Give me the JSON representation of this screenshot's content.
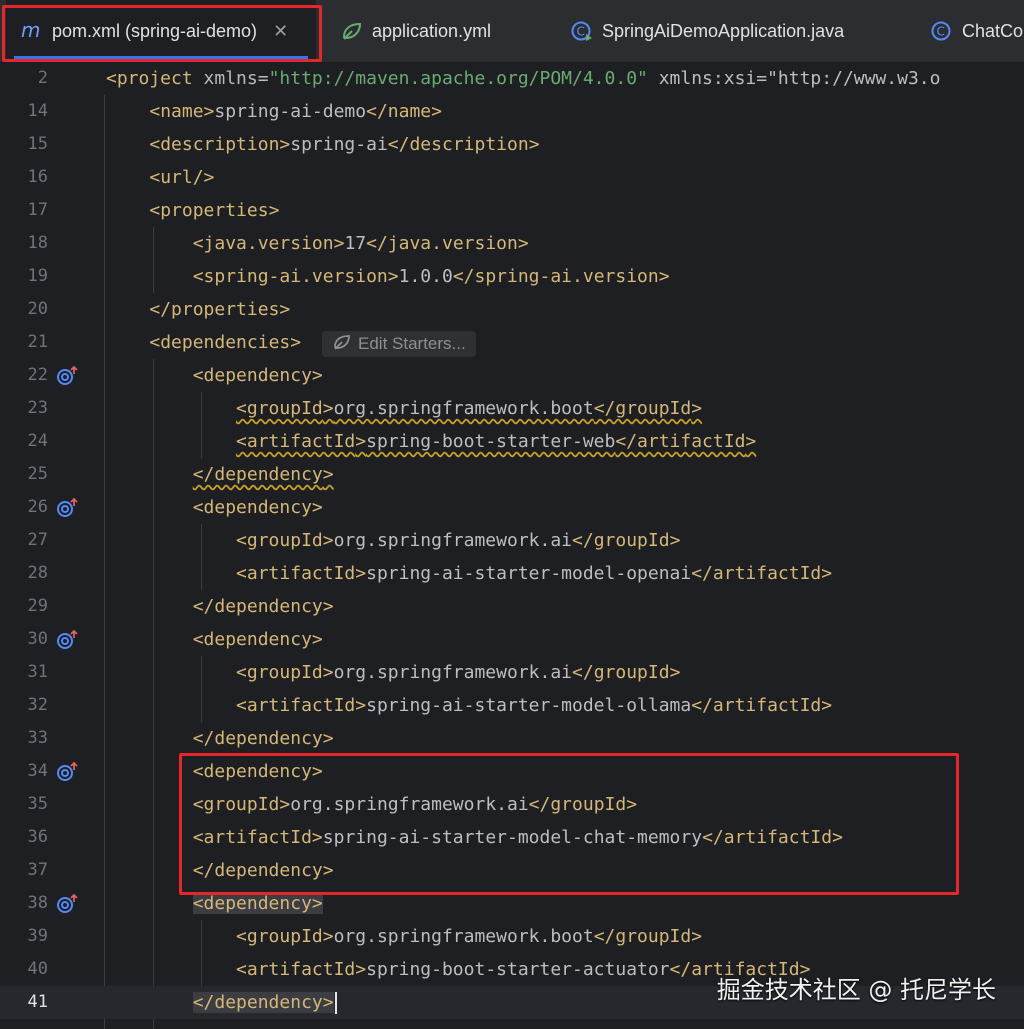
{
  "tabs": [
    {
      "label": "pom.xml (spring-ai-demo)",
      "icon": "maven-icon",
      "active": true
    },
    {
      "label": "application.yml",
      "icon": "spring-leaf-icon",
      "active": false
    },
    {
      "label": "SpringAiDemoApplication.java",
      "icon": "java-class-icon",
      "active": false
    },
    {
      "label": "ChatCo",
      "icon": "class-c-icon",
      "active": false
    }
  ],
  "inlay_hint": {
    "label": "Edit Starters..."
  },
  "watermark": "掘金技术社区 @ 托尼学长",
  "colors": {
    "accent": "#3574f0",
    "tag": "#d5b778",
    "string": "#6aab73",
    "namespace": "#c77dbb",
    "highlight_box": "#e5262a"
  },
  "editor": {
    "current_line": "41",
    "lines": [
      {
        "num": "2",
        "code": "<project xmlns=\"http://maven.apache.org/POM/4.0.0\" xmlns:xsi=\"http://www.w3.o"
      },
      {
        "num": "14",
        "code": "    <name>spring-ai-demo</name>"
      },
      {
        "num": "15",
        "code": "    <description>spring-ai</description>"
      },
      {
        "num": "16",
        "code": "    <url/>"
      },
      {
        "num": "17",
        "code": "    <properties>"
      },
      {
        "num": "18",
        "code": "        <java.version>17</java.version>"
      },
      {
        "num": "19",
        "code": "        <spring-ai.version>1.0.0</spring-ai.version>"
      },
      {
        "num": "20",
        "code": "    </properties>"
      },
      {
        "num": "21",
        "code": "    <dependencies>"
      },
      {
        "num": "22",
        "code": "        <dependency>",
        "gutter_icon": "dependency-arrow-icon"
      },
      {
        "num": "23",
        "code": "            <groupId>org.springframework.boot</groupId>"
      },
      {
        "num": "24",
        "code": "            <artifactId>spring-boot-starter-web</artifactId>"
      },
      {
        "num": "25",
        "code": "        </dependency>"
      },
      {
        "num": "26",
        "code": "        <dependency>",
        "gutter_icon": "dependency-arrow-icon"
      },
      {
        "num": "27",
        "code": "            <groupId>org.springframework.ai</groupId>"
      },
      {
        "num": "28",
        "code": "            <artifactId>spring-ai-starter-model-openai</artifactId>"
      },
      {
        "num": "29",
        "code": "        </dependency>"
      },
      {
        "num": "30",
        "code": "        <dependency>",
        "gutter_icon": "dependency-arrow-icon"
      },
      {
        "num": "31",
        "code": "            <groupId>org.springframework.ai</groupId>"
      },
      {
        "num": "32",
        "code": "            <artifactId>spring-ai-starter-model-ollama</artifactId>"
      },
      {
        "num": "33",
        "code": "        </dependency>"
      },
      {
        "num": "34",
        "code": "        <dependency>",
        "gutter_icon": "dependency-arrow-icon"
      },
      {
        "num": "35",
        "code": "        <groupId>org.springframework.ai</groupId>"
      },
      {
        "num": "36",
        "code": "        <artifactId>spring-ai-starter-model-chat-memory</artifactId>"
      },
      {
        "num": "37",
        "code": "        </dependency>"
      },
      {
        "num": "38",
        "code": "        <dependency>",
        "gutter_icon": "dependency-arrow-icon"
      },
      {
        "num": "39",
        "code": "            <groupId>org.springframework.boot</groupId>"
      },
      {
        "num": "40",
        "code": "            <artifactId>spring-boot-starter-actuator</artifactId>"
      },
      {
        "num": "41",
        "code": "        </dependency>"
      }
    ]
  }
}
